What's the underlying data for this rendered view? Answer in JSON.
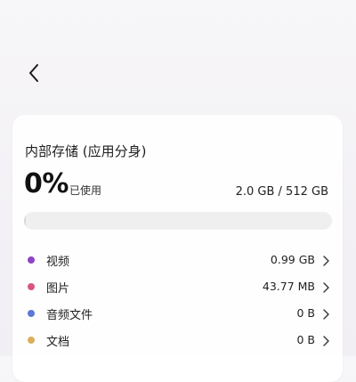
{
  "header": {
    "back_icon": "chevron-left-icon"
  },
  "storage": {
    "title": "内部存储 (应用分身)",
    "percent": "0%",
    "used_label": "已使用",
    "total": "2.0 GB / 512 GB",
    "used_fraction": 0.004
  },
  "categories": [
    {
      "label": "视频",
      "size": "0.99 GB",
      "color": "#8e44c4"
    },
    {
      "label": "图片",
      "size": "43.77 MB",
      "color": "#d9577f"
    },
    {
      "label": "音频文件",
      "size": "0 B",
      "color": "#5b79d6"
    },
    {
      "label": "文档",
      "size": "0 B",
      "color": "#dcae5c"
    }
  ]
}
